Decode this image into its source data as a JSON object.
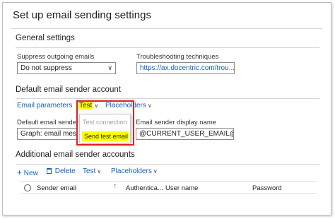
{
  "page": {
    "title": "Set up email sending settings"
  },
  "general": {
    "section_title": "General settings",
    "suppress": {
      "label": "Suppress outgoing emails",
      "value": "Do not suppress"
    },
    "troubleshooting": {
      "label": "Troubleshooting techniques",
      "value": "https://ax.docentric.com/trou..."
    }
  },
  "default_account": {
    "section_title": "Default email sender account",
    "toolbar": {
      "email_parameters": "Email parameters",
      "test": "Test",
      "placeholders": "Placeholders"
    },
    "test_menu": {
      "test_connection": "Test connection",
      "send_test_email": "Send test email"
    },
    "sender": {
      "label": "Default email sender",
      "value": "Graph: email mess"
    },
    "display_name": {
      "label": "Email sender display name",
      "value": "@CURRENT_USER_EMAIL@"
    }
  },
  "additional_accounts": {
    "section_title": "Additional email sender accounts",
    "toolbar": {
      "new": "New",
      "delete": "Delete",
      "test": "Test",
      "placeholders": "Placeholders"
    },
    "columns": {
      "sender_email": "Sender email",
      "authentication": "Authentica...",
      "user_name": "User name",
      "password": "Password"
    }
  },
  "colors": {
    "link": "#1a5fb4",
    "highlight": "#ffff00",
    "callout": "#e02020"
  },
  "icons": {
    "chevron": "chevron-down-icon",
    "new": "plus-icon",
    "delete": "trash-icon",
    "sort": "sort-arrow-icon"
  }
}
